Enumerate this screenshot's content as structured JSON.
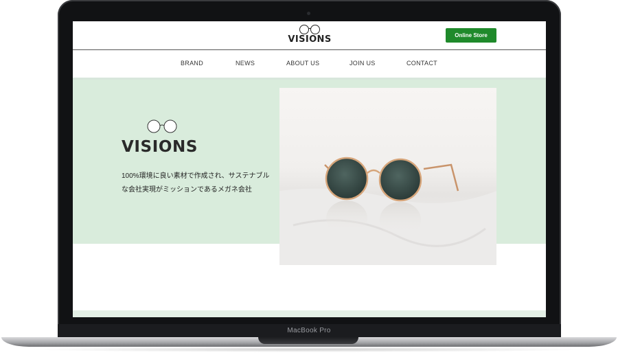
{
  "site": {
    "brand": "VISIONS",
    "online_store": "Online Store",
    "nav": [
      "BRAND",
      "NEWS",
      "ABOUT US",
      "JOIN US",
      "CONTACT"
    ]
  },
  "hero": {
    "brand": "VISIONS",
    "tagline_line1": "100%環境に良い素材で作成され、サステナブル",
    "tagline_line2": "な会社実現がミッションであるメガネ会社"
  },
  "device": {
    "label": "MacBook Pro"
  },
  "colors": {
    "accent_green": "#1f8a2b",
    "hero_background": "#d9ecdc",
    "text_dark": "#222222"
  },
  "icons": [
    "glasses-logo-icon",
    "sunglasses-photo"
  ]
}
